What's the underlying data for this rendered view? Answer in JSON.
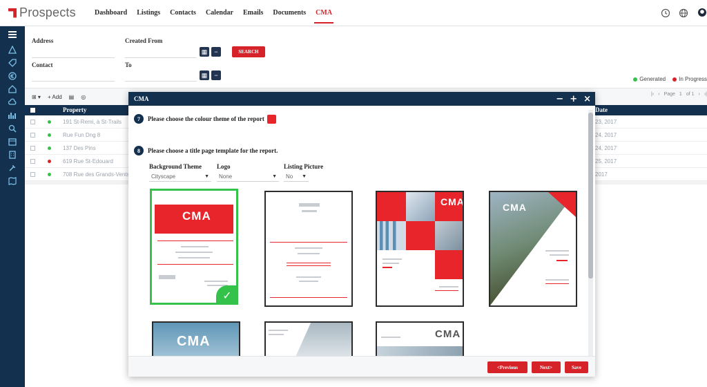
{
  "app": {
    "name": "Prospects"
  },
  "nav": {
    "items": [
      {
        "label": "Dashboard"
      },
      {
        "label": "Listings"
      },
      {
        "label": "Contacts"
      },
      {
        "label": "Calendar"
      },
      {
        "label": "Emails"
      },
      {
        "label": "Documents"
      },
      {
        "label": "CMA",
        "active": true
      }
    ]
  },
  "header_icons": [
    "clock-icon",
    "globe-icon",
    "user-icon"
  ],
  "sidebar_icons": [
    "menu-icon",
    "warning-icon",
    "tag-icon",
    "euro-icon",
    "home-icon",
    "cloud-icon",
    "chart-icon",
    "search-icon",
    "calendar-icon",
    "building-icon",
    "tools-icon",
    "map-icon"
  ],
  "filters": {
    "address_label": "Address",
    "contact_label": "Contact",
    "created_from_label": "Created From",
    "to_label": "To",
    "search_button": "SEARCH"
  },
  "legend": {
    "generated": "Generated",
    "in_progress": "In Progress",
    "generated_color": "#35c24a",
    "in_progress_color": "#d6232a"
  },
  "table": {
    "toolbar": {
      "view": "⊞ ▾",
      "add": "+ Add"
    },
    "pager": {
      "page_label": "Page",
      "of_label": "of 1"
    },
    "headers": {
      "property": "Property",
      "date": "Date"
    },
    "rows": [
      {
        "address": "191 St-Remi, à St-Trails",
        "date": "23, 2017",
        "status": "generated"
      },
      {
        "address": "Rue Fun Dng 8",
        "date": "24, 2017",
        "status": "generated"
      },
      {
        "address": "137 Des Pins",
        "date": "24, 2017",
        "status": "generated"
      },
      {
        "address": "619 Rue St-Edouard",
        "date": "25, 2017",
        "status": "in_progress"
      },
      {
        "address": "708 Rue des Grands-Vents",
        "date": "2017",
        "status": "generated"
      }
    ]
  },
  "modal": {
    "title": "CMA",
    "step7": {
      "number": "7",
      "text": "Please choose the colour theme of the report",
      "theme_color": "#e8252b"
    },
    "step8": {
      "number": "8",
      "text": "Please choose a title page template for the report."
    },
    "background_theme": {
      "label": "Background Theme",
      "value": "Cityscape"
    },
    "logo": {
      "label": "Logo",
      "value": "None"
    },
    "listing_picture": {
      "label": "Listing Picture",
      "value": "No"
    },
    "templates": [
      {
        "name": "CMA",
        "selected": true
      },
      {
        "name": ""
      },
      {
        "name": "CMA"
      },
      {
        "name": "CMA"
      },
      {
        "name": "CMA"
      },
      {
        "name": ""
      },
      {
        "name": "CMA"
      }
    ],
    "footer": {
      "previous": "<Previous",
      "next": "Next>",
      "save": "Save"
    }
  }
}
